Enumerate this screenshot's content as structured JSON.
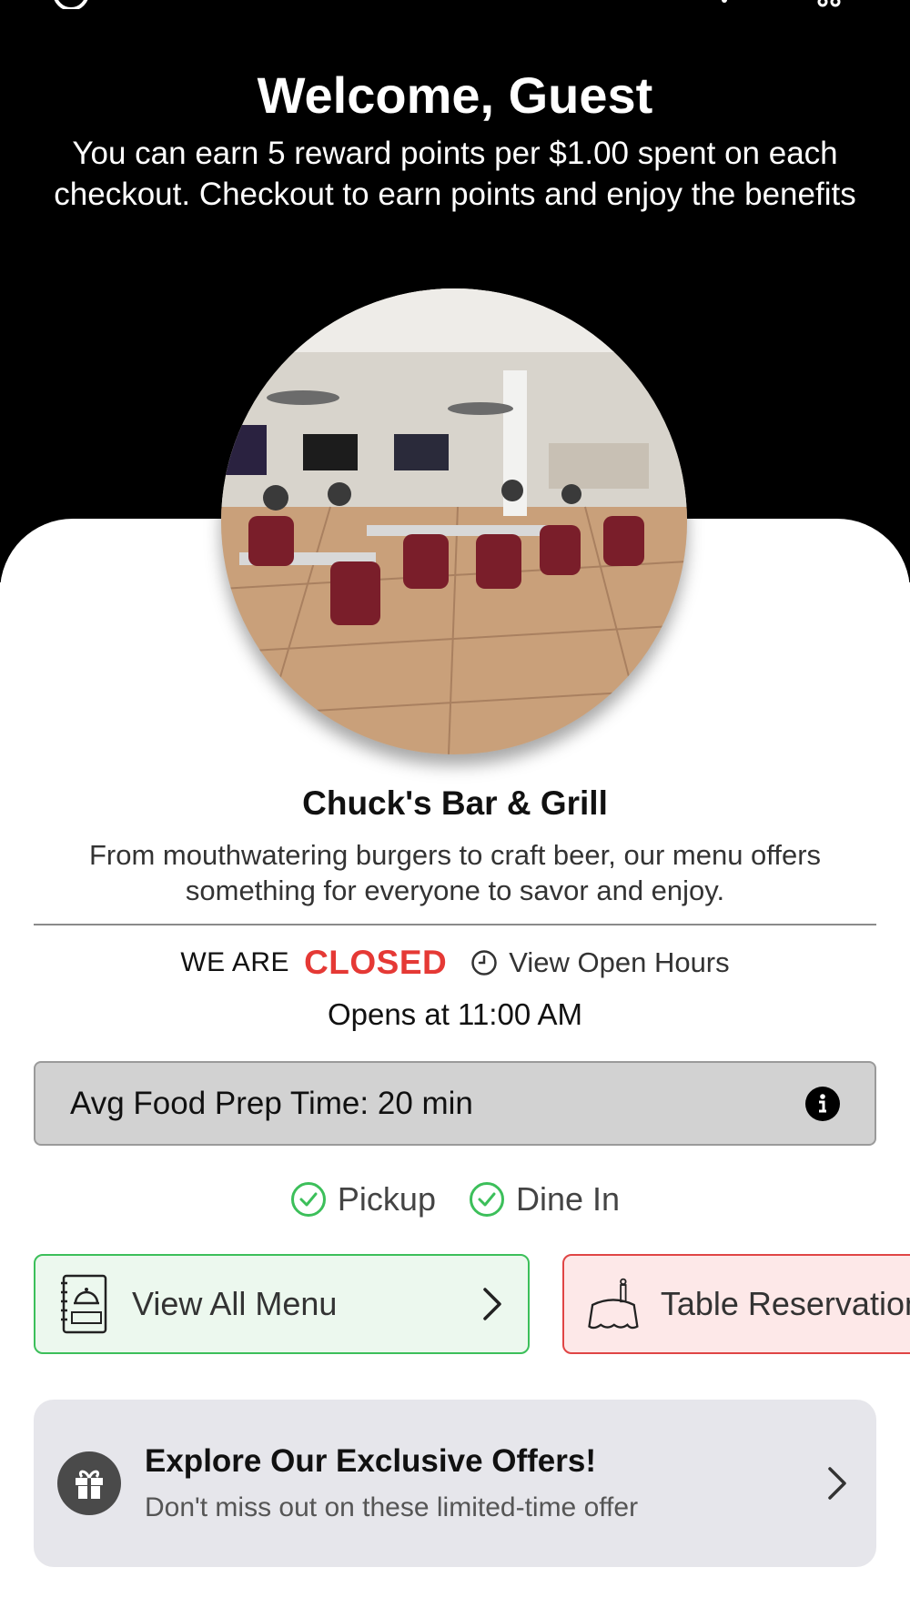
{
  "header": {
    "welcome_title": "Welcome, Guest",
    "reward_message": "You can earn 5 reward points per $1.00 spent on each checkout. Checkout to earn points and enjoy the benefits"
  },
  "restaurant": {
    "name": "Chuck's Bar & Grill",
    "description": "From mouthwatering burgers to craft beer, our menu offers something for everyone to savor and enjoy."
  },
  "status": {
    "prefix": "WE ARE",
    "state": "CLOSED",
    "hours_link": "View Open Hours",
    "opens_at": "Opens at 11:00 AM"
  },
  "prep_time": {
    "label": "Avg Food Prep Time: 20 min"
  },
  "services": [
    {
      "label": "Pickup"
    },
    {
      "label": "Dine In"
    }
  ],
  "actions": {
    "menu_label": "View All Menu",
    "reservation_label": "Table Reservation"
  },
  "offers": {
    "title": "Explore Our Exclusive Offers!",
    "subtitle": "Don't miss out on these limited-time offer"
  },
  "colors": {
    "closed": "#e53935",
    "check_green": "#3cbf5a",
    "menu_border": "#3cbf5a",
    "reservation_border": "#e04545"
  }
}
